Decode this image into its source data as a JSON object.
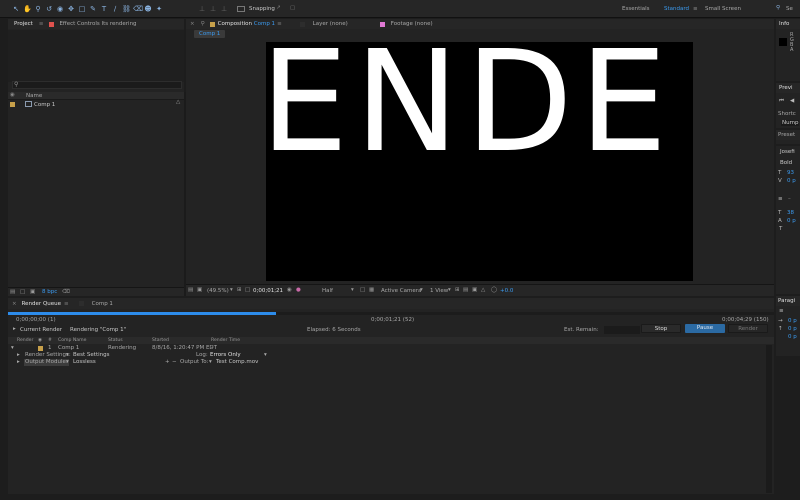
{
  "toolbar": {
    "snapping_label": "Snapping",
    "workspaces": [
      {
        "label": "Essentials",
        "active": false
      },
      {
        "label": "Standard",
        "active": true
      },
      {
        "label": "Small Screen",
        "active": false
      }
    ],
    "search_label": "Se"
  },
  "project_panel": {
    "tab_project": "Project",
    "tab_effect_controls": "Effect Controls Its rendering",
    "column_name": "Name",
    "items": [
      {
        "name": "Comp 1"
      }
    ],
    "bpc_label": "8 bpc"
  },
  "viewer": {
    "tab_composition_prefix": "Composition",
    "tab_composition_name": "Comp 1",
    "tab_layer": "Layer (none)",
    "tab_footage": "Footage (none)",
    "comp_pill": "Comp 1",
    "canvas_text": "ENDE",
    "zoom": "(49.5%)",
    "timecode": "0;00;01;21",
    "resolution": "Half",
    "camera": "Active Camera",
    "views": "1 View",
    "exposure": "+0.0"
  },
  "render_queue": {
    "tab_render_queue": "Render Queue",
    "tab_comp": "Comp 1",
    "time_start": "0;00;00;00 (1)",
    "time_current": "0;00;01;21 (52)",
    "time_end": "0;00;04;29 (150)",
    "progress": 0.35,
    "current_render_label": "Current Render",
    "rendering_status": "Rendering \"Comp 1\"",
    "elapsed": "Elapsed: 6 Seconds",
    "est_remain": "Est. Remain:",
    "stop_label": "Stop",
    "pause_label": "Pause",
    "render_label": "Render",
    "columns": [
      "Render",
      "#",
      "Comp Name",
      "Status",
      "Started",
      "Render Time"
    ],
    "item": {
      "number": "1",
      "comp_name": "Comp 1",
      "status": "Rendering",
      "started": "8/8/16, 1:20:47 PM EDT",
      "render_time": "-"
    },
    "render_settings_label": "Render Settings:",
    "render_settings_value": "Best Settings",
    "log_label": "Log:",
    "log_value": "Errors Only",
    "output_module_label": "Output Module:",
    "output_module_value": "Lossless",
    "output_to_label": "Output To:",
    "output_to_value": "Test Comp.mov"
  },
  "right_panels": {
    "info_label": "Info",
    "info_letters": [
      "R",
      "G",
      "B",
      "A"
    ],
    "preview_label": "Previ",
    "shortcut_label": "Shortc",
    "shortcut_value": "Nump",
    "presets_label": "Preset",
    "font_name": "Josefi",
    "font_style": "Bold",
    "values": [
      "93",
      "0 p",
      "38",
      "0 p"
    ],
    "paragraph_label": "Paragi",
    "para_values": [
      "0 p",
      "0 p",
      "0 p"
    ]
  },
  "colors": {
    "accent": "#2d8ceb",
    "pause_button": "#2b6aa3",
    "comp_label": "#c7a04a",
    "effect_label": "#e0524e",
    "footage_label": "#e079d4"
  }
}
